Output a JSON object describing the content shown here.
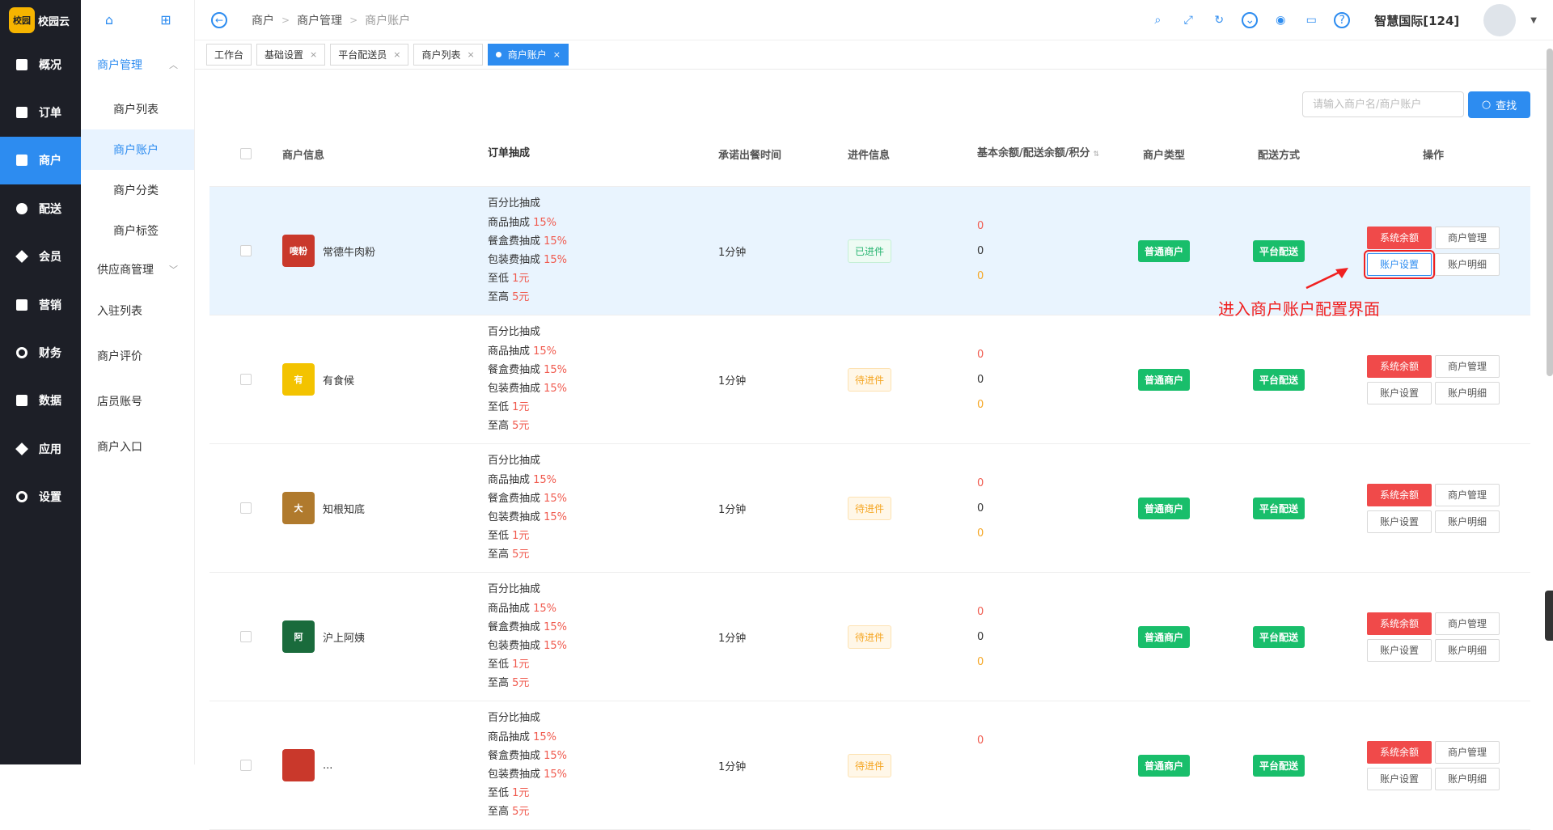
{
  "app": {
    "brand": "校园云",
    "logo_text": "校园"
  },
  "nav": [
    {
      "label": "概况",
      "icon": "overview-icon"
    },
    {
      "label": "订单",
      "icon": "order-icon"
    },
    {
      "label": "商户",
      "icon": "merchant-icon",
      "active": true
    },
    {
      "label": "配送",
      "icon": "delivery-icon"
    },
    {
      "label": "会员",
      "icon": "member-icon"
    },
    {
      "label": "营销",
      "icon": "marketing-icon"
    },
    {
      "label": "财务",
      "icon": "finance-icon"
    },
    {
      "label": "数据",
      "icon": "data-icon"
    },
    {
      "label": "应用",
      "icon": "app-icon"
    },
    {
      "label": "设置",
      "icon": "settings-icon"
    }
  ],
  "submenu": {
    "group1": "商户管理",
    "items": [
      "商户列表",
      "商户账户",
      "商户分类",
      "商户标签"
    ],
    "group2": "供应商管理",
    "plain": [
      "入驻列表",
      "商户评价",
      "店员账号",
      "商户入口"
    ]
  },
  "breadcrumb": [
    "商户",
    "商户管理",
    "商户账户"
  ],
  "header": {
    "user": "智慧国际[124]"
  },
  "tabs": [
    {
      "label": "工作台",
      "closable": false
    },
    {
      "label": "基础设置",
      "closable": true
    },
    {
      "label": "平台配送员",
      "closable": true
    },
    {
      "label": "商户列表",
      "closable": true
    },
    {
      "label": "商户账户",
      "closable": true,
      "active": true
    }
  ],
  "search": {
    "placeholder": "请输入商户名/商户账户",
    "button": "查找"
  },
  "columns": {
    "info": "商户信息",
    "commission": "订单抽成",
    "time": "承诺出餐时间",
    "progress": "进件信息",
    "balance": "基本余额/配送余额/积分",
    "type": "商户类型",
    "shipping": "配送方式",
    "ops": "操作"
  },
  "rows": [
    {
      "name": "常德牛肉粉",
      "logo_color": "#c9382b",
      "logo_text": "嗖粉",
      "time": "1分钟",
      "progress": "已进件",
      "progress_state": "ok",
      "balance": [
        "0",
        "0",
        "0"
      ],
      "highlight": true
    },
    {
      "name": "有食候",
      "logo_color": "#f3c300",
      "logo_text": "有",
      "time": "1分钟",
      "progress": "待进件",
      "progress_state": "wait",
      "balance": [
        "0",
        "0",
        "0"
      ]
    },
    {
      "name": "知根知底",
      "logo_color": "#b07a2d",
      "logo_text": "大",
      "time": "1分钟",
      "progress": "待进件",
      "progress_state": "wait",
      "balance": [
        "0",
        "0",
        "0"
      ]
    },
    {
      "name": "沪上阿姨",
      "logo_color": "#1a6b3c",
      "logo_text": "阿",
      "time": "1分钟",
      "progress": "待进件",
      "progress_state": "wait",
      "balance": [
        "0",
        "0",
        "0"
      ]
    },
    {
      "name": "...",
      "logo_color": "#c9382b",
      "logo_text": "",
      "time": "1分钟",
      "progress": "待进件",
      "progress_state": "wait",
      "balance": [
        "0",
        "",
        ""
      ]
    }
  ],
  "commission": {
    "title": "百分比抽成",
    "lines": [
      {
        "label": "商品抽成 ",
        "value": "15%"
      },
      {
        "label": "餐盒费抽成 ",
        "value": "15%"
      },
      {
        "label": "包装费抽成 ",
        "value": "15%"
      },
      {
        "label": "至低 ",
        "value": "1元"
      },
      {
        "label": "至高 ",
        "value": "5元"
      }
    ]
  },
  "tags": {
    "type": "普通商户",
    "shipping": "平台配送"
  },
  "ops": {
    "balance": "系统余额",
    "manage": "商户管理",
    "settings": "账户设置",
    "detail": "账户明细"
  },
  "annotation": "进入商户账户配置界面",
  "colors": {
    "primary": "#2d8cf0",
    "sidebar": "#1d1f27",
    "danger": "#f04a4a",
    "success": "#19be6b",
    "annotation": "#f02020"
  }
}
